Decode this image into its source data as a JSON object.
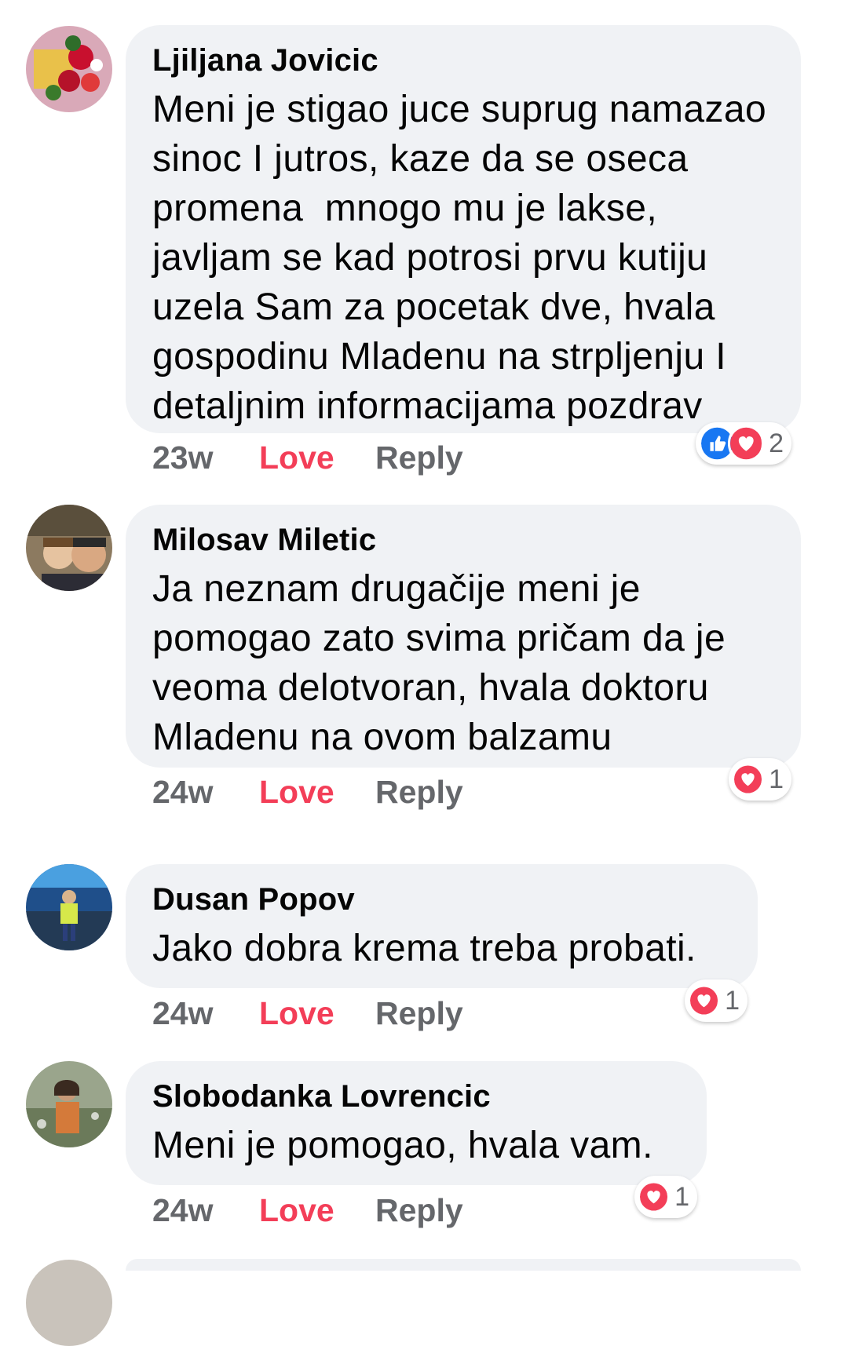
{
  "comments": [
    {
      "author": "Ljiljana Jovicic",
      "text": "Meni je stigao juce suprug namazao\nsinoc I jutros, kaze da se oseca\npromena  mnogo mu je lakse,\njavljam se kad potrosi prvu kutiju\nuzela Sam za pocetak dve, hvala\ngospodinu Mladenu na strpljenju I\ndetaljnim informacijama pozdrav",
      "time": "23w",
      "love_label": "Love",
      "reply_label": "Reply",
      "reactions": [
        "like",
        "love"
      ],
      "reaction_count": "2"
    },
    {
      "author": "Milosav Miletic",
      "text": "Ja neznam drugačije meni je\npomogao zato svima pričam da je\nveoma delotvoran, hvala doktoru\nMladenu na ovom balzamu",
      "time": "24w",
      "love_label": "Love",
      "reply_label": "Reply",
      "reactions": [
        "love"
      ],
      "reaction_count": "1"
    },
    {
      "author": "Dusan Popov",
      "text": "Jako dobra krema treba probati.",
      "time": "24w",
      "love_label": "Love",
      "reply_label": "Reply",
      "reactions": [
        "love"
      ],
      "reaction_count": "1"
    },
    {
      "author": "Slobodanka Lovrencic",
      "text": "Meni je pomogao, hvala vam.",
      "time": "24w",
      "love_label": "Love",
      "reply_label": "Reply",
      "reactions": [
        "love"
      ],
      "reaction_count": "1"
    }
  ],
  "colors": {
    "bubble": "#f0f2f5",
    "love_text": "#f33e58",
    "meta_text": "#65676b",
    "like_blue": "#1877f2",
    "love_red": "#f33e58"
  }
}
